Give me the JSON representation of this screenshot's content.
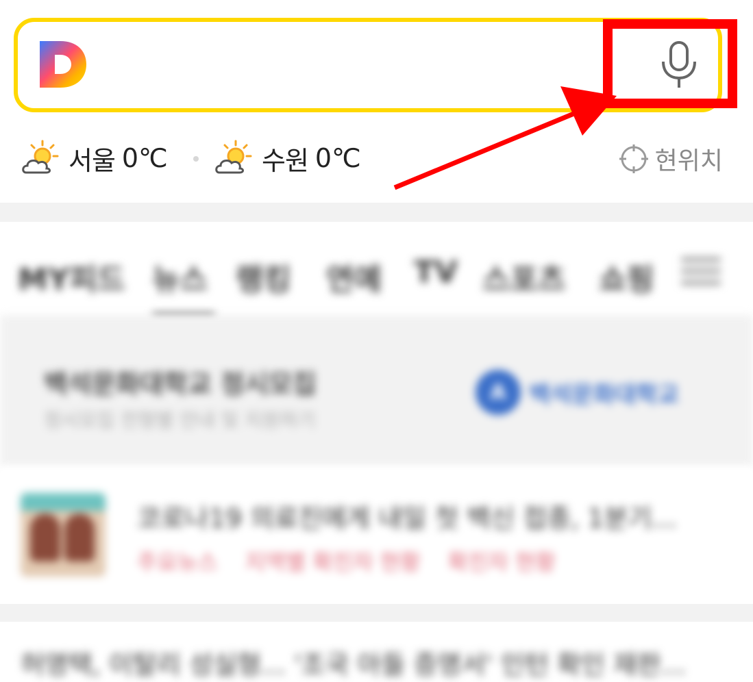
{
  "search": {
    "logo_letter": "D",
    "placeholder": ""
  },
  "weather": [
    {
      "city": "서울",
      "temp": "0℃",
      "icon": "partly-cloudy-icon"
    },
    {
      "city": "수원",
      "temp": "0℃",
      "icon": "partly-cloudy-icon"
    }
  ],
  "location_button": "현위치",
  "tabs": [
    {
      "label": "MY피드"
    },
    {
      "label": "뉴스"
    },
    {
      "label": "랭킹"
    },
    {
      "label": "연예"
    },
    {
      "label": "TV"
    },
    {
      "label": "스포츠"
    },
    {
      "label": "쇼핑"
    }
  ],
  "ad": {
    "title": "백석문화대학교 정시모집",
    "subtitle": "정시모집 전형별 안내 및 지원하기",
    "logo_text": "백석문화대학교"
  },
  "news_item": {
    "title": "코로나19 의료진에게 내일 첫 백신 접종, 1분기...",
    "tags": [
      "주요뉴스",
      "지역별 확진자 현황",
      "확진자 현황"
    ]
  },
  "news_item2": {
    "title": "허영택, 이탈리 성실형... '조국 아들 증명서' 인턴 확인 재판..."
  },
  "colors": {
    "search_border": "#ffd800",
    "annotation": "#ff0000"
  }
}
